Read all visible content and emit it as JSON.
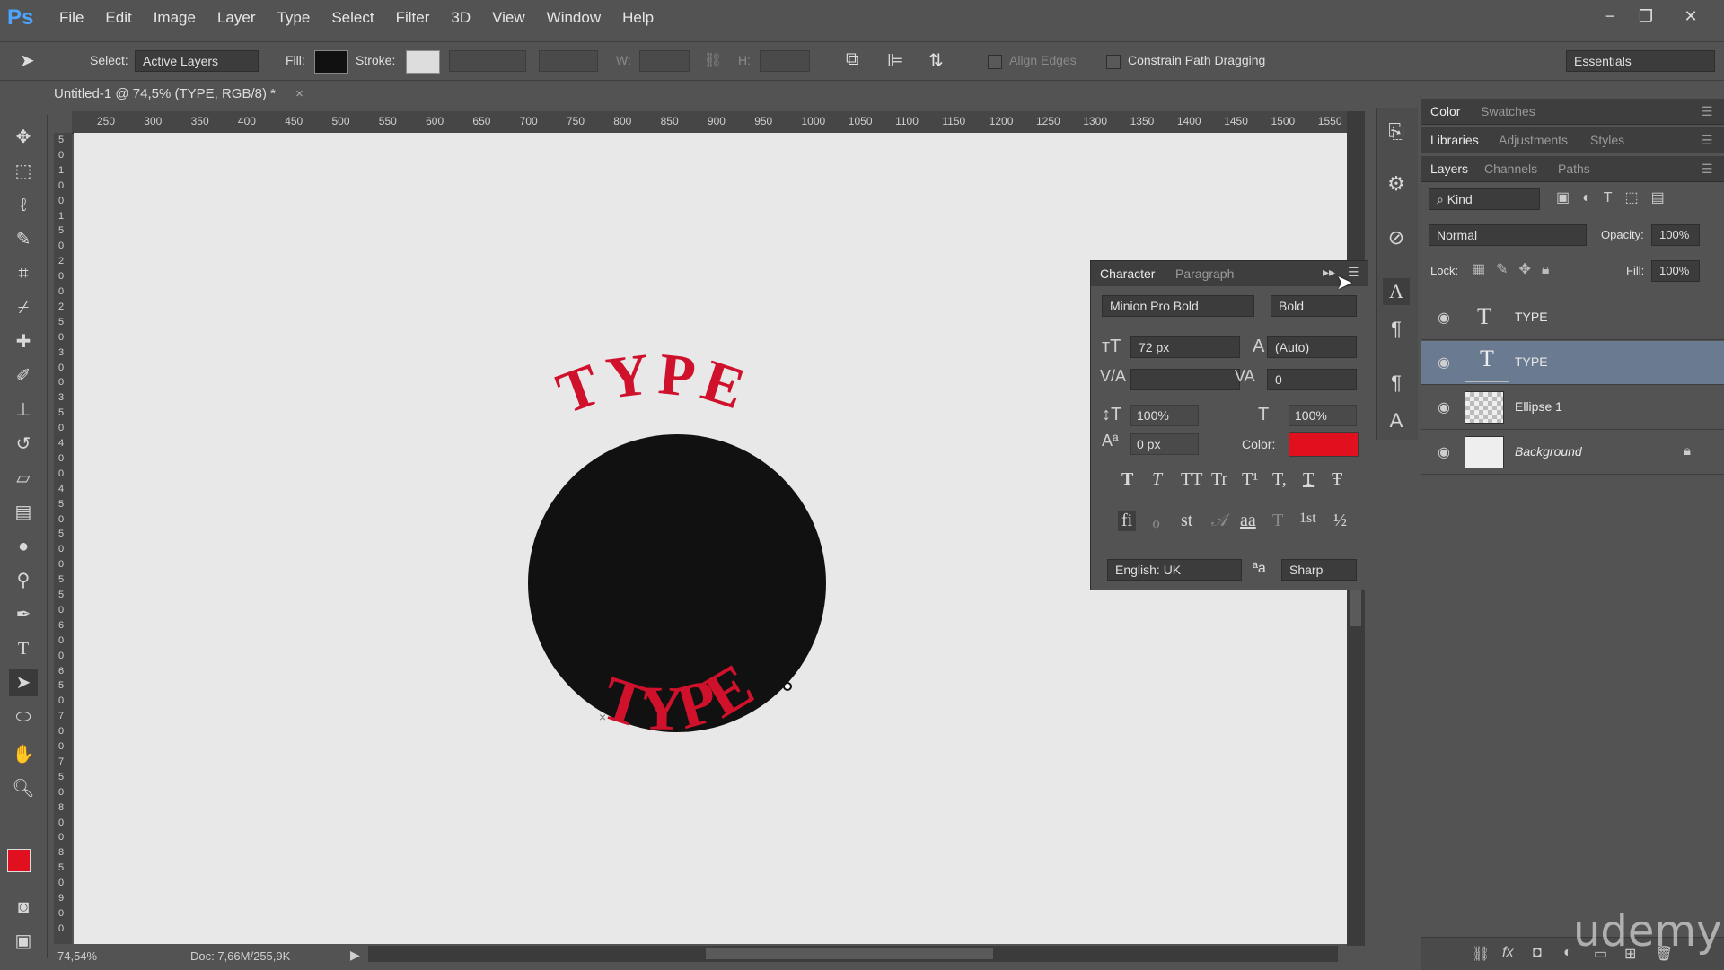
{
  "app": {
    "logo": "Ps"
  },
  "menu": [
    "File",
    "Edit",
    "Image",
    "Layer",
    "Type",
    "Select",
    "Filter",
    "3D",
    "View",
    "Window",
    "Help"
  ],
  "window": {
    "minimize": "−",
    "restore": "❐",
    "close": "✕"
  },
  "options": {
    "select_label": "Select:",
    "select_value": "Active Layers",
    "fill_label": "Fill:",
    "stroke_label": "Stroke:",
    "w_label": "W:",
    "h_label": "H:",
    "align_edges": "Align Edges",
    "constrain": "Constrain Path Dragging",
    "workspace": "Essentials"
  },
  "document": {
    "tab": "Untitled-1 @ 74,5% (TYPE, RGB/8) *",
    "close": "×"
  },
  "ruler": {
    "top": [
      "250",
      "300",
      "350",
      "400",
      "450",
      "500",
      "550",
      "600",
      "650",
      "700",
      "750",
      "800",
      "850",
      "900",
      "950",
      "1000",
      "1050",
      "1100",
      "1150",
      "1200",
      "1250",
      "1300",
      "1350",
      "1400",
      "1450",
      "1500",
      "1550"
    ],
    "left": [
      "5",
      "0",
      "1",
      "0",
      "0",
      "1",
      "5",
      "0",
      "2",
      "0",
      "0",
      "2",
      "5",
      "0",
      "3",
      "0",
      "0",
      "3",
      "5",
      "0",
      "4",
      "0",
      "0",
      "4",
      "5",
      "0",
      "5",
      "0",
      "0",
      "5",
      "5",
      "0",
      "6",
      "0",
      "0",
      "6",
      "5",
      "0",
      "7",
      "0",
      "0",
      "7",
      "5",
      "0",
      "8",
      "0",
      "0",
      "8",
      "5",
      "0",
      "9",
      "0",
      "0"
    ]
  },
  "artwork": {
    "text_top": "TYPE",
    "text_bottom": "TYPE",
    "circle_color": "#111111",
    "text_color": "#d0112b"
  },
  "status": {
    "zoom": "74,54%",
    "doc": "Doc: 7,66M/255,9K"
  },
  "character": {
    "tab_active": "Character",
    "tab_other": "Paragraph",
    "font_family": "Minion Pro Bold",
    "font_style": "Bold",
    "size": "72 px",
    "leading": "(Auto)",
    "kerning": "",
    "tracking": "0",
    "vscale": "100%",
    "hscale": "100%",
    "baseline": "0 px",
    "color_label": "Color:",
    "color": "#e0101f",
    "style_buttons": [
      "T",
      "T",
      "TT",
      "Tr",
      "T¹",
      "T,",
      "T",
      "Ŧ"
    ],
    "opentype_buttons": [
      "fi",
      "ℴ",
      "st",
      "𝒜",
      "aa",
      "T",
      "1st",
      "½"
    ],
    "language": "English: UK",
    "aa_label": "ªa",
    "antialias": "Sharp"
  },
  "panels": {
    "row1": [
      "Color",
      "Swatches"
    ],
    "row2": [
      "Libraries",
      "Adjustments",
      "Styles"
    ],
    "row3": [
      "Layers",
      "Channels",
      "Paths"
    ],
    "kind": "Kind",
    "blend": "Normal",
    "opacity_label": "Opacity:",
    "opacity": "100%",
    "lock_label": "Lock:",
    "fill_label": "Fill:",
    "fill": "100%",
    "layers": [
      {
        "name": "TYPE",
        "type": "text",
        "selected": false
      },
      {
        "name": "TYPE",
        "type": "text",
        "selected": true
      },
      {
        "name": "Ellipse 1",
        "type": "shape",
        "selected": false
      },
      {
        "name": "Background",
        "type": "bg",
        "selected": false
      }
    ],
    "footer": [
      "⛓",
      "fx",
      "◘",
      "◐",
      "▭",
      "⊞",
      "🗑"
    ]
  },
  "watermark": "udemy"
}
